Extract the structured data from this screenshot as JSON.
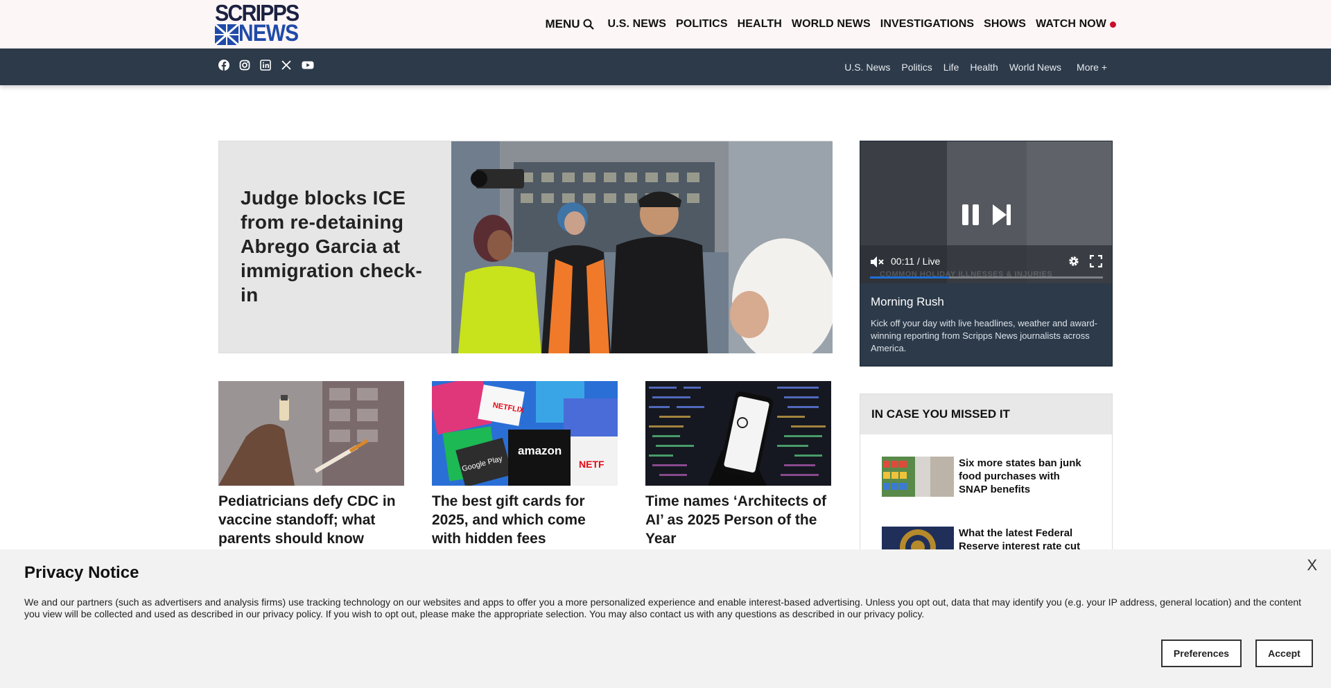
{
  "header": {
    "logo_line1": "SCRIPPS",
    "logo_line2": "NEWS",
    "menu_label": "MENU",
    "nav": [
      "U.S. NEWS",
      "POLITICS",
      "HEALTH",
      "WORLD NEWS",
      "INVESTIGATIONS",
      "SHOWS",
      "WATCH NOW"
    ]
  },
  "social_icons": [
    "facebook-icon",
    "instagram-icon",
    "linkedin-icon",
    "x-icon",
    "youtube-icon"
  ],
  "sub_nav": [
    "U.S. News",
    "Politics",
    "Life",
    "Health",
    "World News",
    "More +"
  ],
  "hero": {
    "title": "Judge blocks ICE from re-detaining Abrego Garcia at immigration check-in"
  },
  "cards": [
    {
      "title": "Pediatricians defy CDC in vaccine standoff; what parents should know"
    },
    {
      "title": "The best gift cards for 2025, and which come with hidden fees"
    },
    {
      "title": "Time names ‘Architects of AI’ as 2025 Person of the Year"
    }
  ],
  "video": {
    "time": "00:11 / Live",
    "ticker": "COMMON HOLIDAY ILLNESSES & INJURIES",
    "progress": 0.34,
    "title": "Morning Rush",
    "description": "Kick off your day with live headlines, weather and award-winning reporting from Scripps News journalists across America."
  },
  "missed": {
    "heading": "IN CASE YOU MISSED IT",
    "items": [
      {
        "title": "Six more states ban junk food purchases with SNAP benefits"
      },
      {
        "title": "What the latest Federal Reserve interest rate cut"
      }
    ]
  },
  "privacy": {
    "title": "Privacy Notice",
    "close": "X",
    "text": "We and our partners (such as advertisers and analysis firms) use tracking technology on our websites and apps to offer you a more personalized experience and enable interest-based advertising. Unless you opt out, data that may identify you (e.g. your IP address, general location) and the content you view will be collected and used as described in our privacy policy. If you wish to opt out, please make the appropriate selection. You may also contact us with any questions as described in our privacy policy.",
    "preferences_label": "Preferences",
    "accept_label": "Accept"
  },
  "colors": {
    "sub_bar": "#2c3a4a",
    "brand_blue": "#1f4aa8",
    "live_red": "#c8102e"
  }
}
